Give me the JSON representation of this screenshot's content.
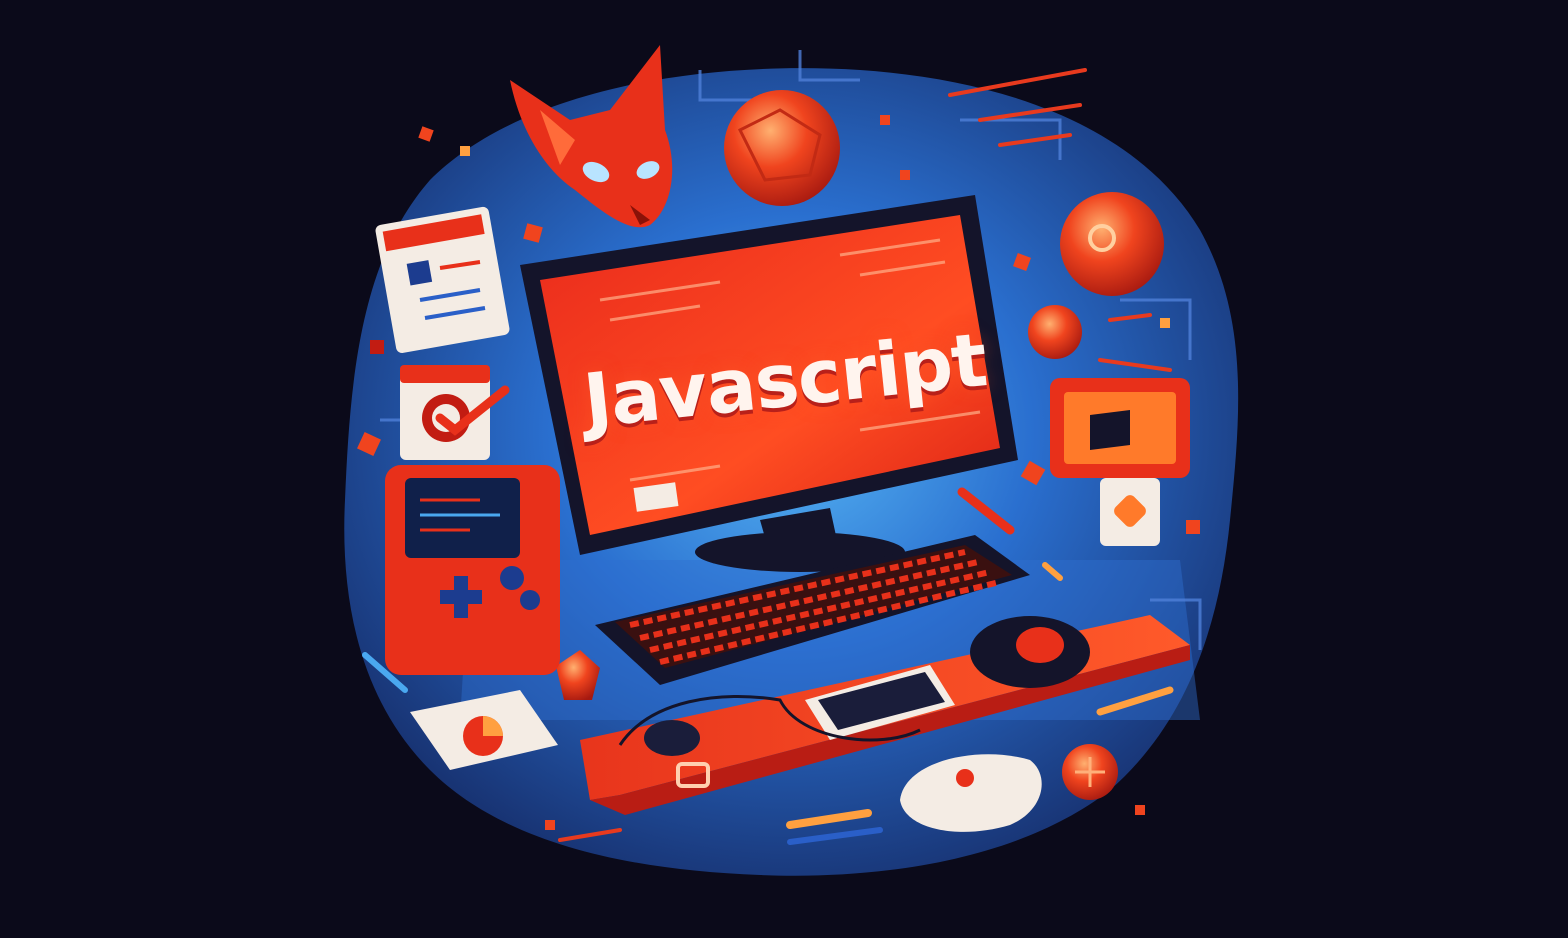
{
  "illustration": {
    "screen_text": "Javascript",
    "colors": {
      "background": "#0b0a1a",
      "blob": "#1b3f8f",
      "glow": "#4aa8f0",
      "accent": "#f23a1c",
      "accent_dark": "#b91d14",
      "highlight": "#ff7a2a",
      "panel": "#f4ece4"
    },
    "objects": [
      "fox-mask-icon",
      "sphere-icon",
      "monitor",
      "keyboard",
      "mouse",
      "desk-mat",
      "tablet",
      "handheld-console",
      "document-card",
      "checkbox-card",
      "media-player-card",
      "pie-chart-card",
      "pencil-icon"
    ]
  }
}
